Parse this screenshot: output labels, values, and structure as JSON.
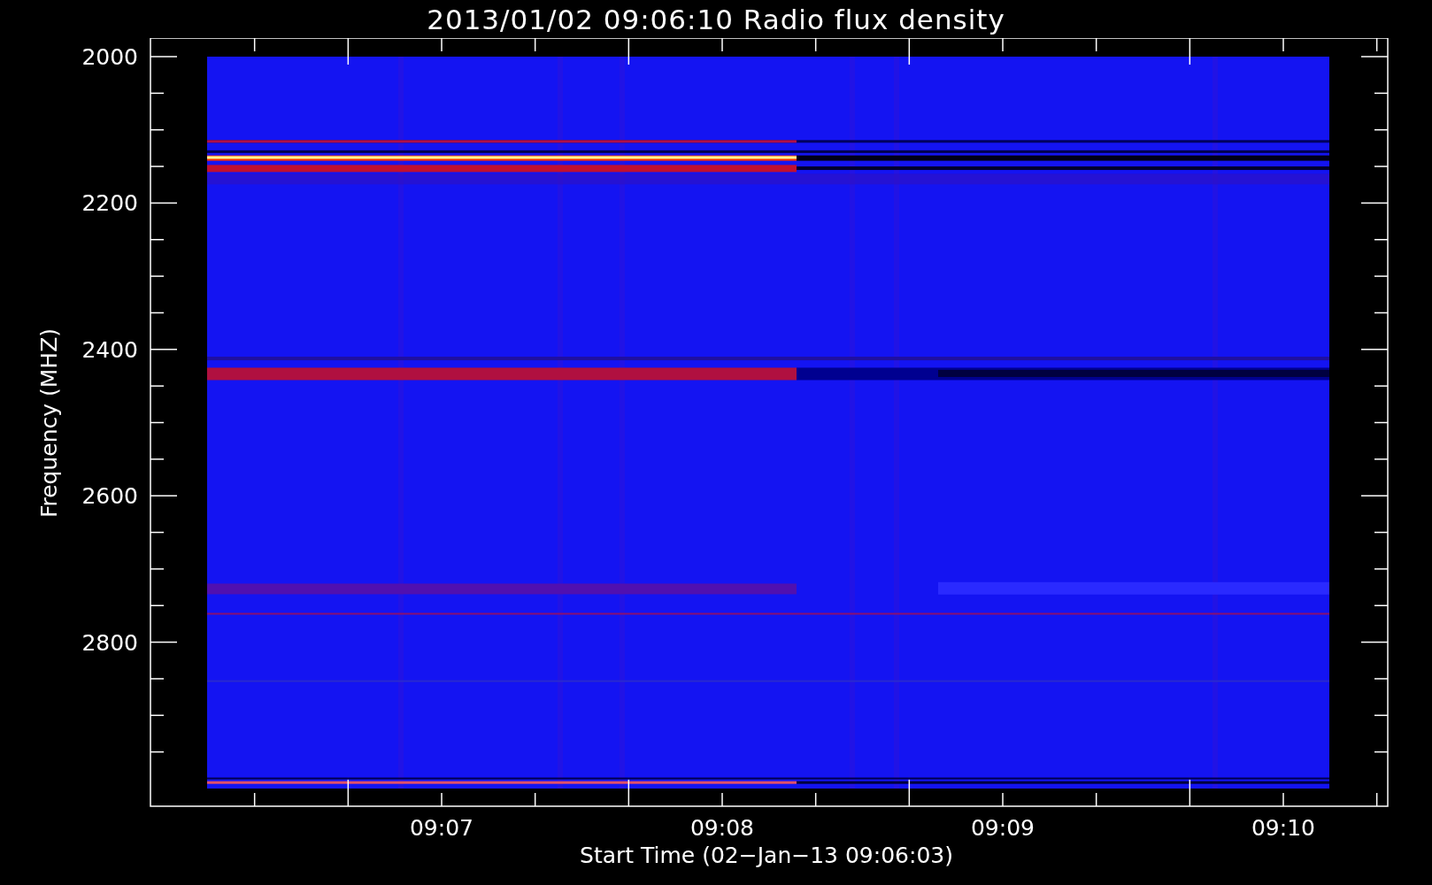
{
  "title": "2013/01/02 09:06:10 Radio flux density",
  "y_axis": {
    "label": "Frequency (MHZ)",
    "tick_labels": [
      "2000",
      "2200",
      "2400",
      "2600",
      "2800"
    ]
  },
  "x_axis": {
    "label": "Start Time (02−Jan−13 09:06:03)",
    "tick_labels": [
      "09:07",
      "09:08",
      "09:09",
      "09:10"
    ]
  }
}
